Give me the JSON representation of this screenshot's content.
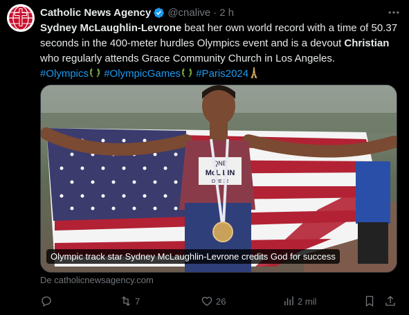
{
  "author": {
    "name": "Catholic News Agency",
    "handle": "@cnalive",
    "separator": "·",
    "time": "2 h",
    "avatar_icon": "cna-logo"
  },
  "tweet": {
    "part1_bold": "Sydney McLaughlin-Levrone",
    "part2": " beat her own world record with a time of 50.37 seconds in the 400-meter hurdles Olympics event and is a devout ",
    "part3_bold": "Christian",
    "part4": " who regularly attends Grace Community Church in Los Angeles.",
    "hashtags": [
      "#Olympics",
      "#OlympicGames",
      "#Paris2024"
    ],
    "hashtag_emojis": [
      "laurel-emoji",
      "laurel-emoji",
      "eiffel-tower-emoji"
    ]
  },
  "media": {
    "caption": "Olympic track star Sydney McLaughlin-Levrone credits God for success",
    "bib_line1": "QNB",
    "bib_line2": "McL   LIN",
    "bib_line3": "ORE   22"
  },
  "source": "De catholicnewsagency.com",
  "actions": {
    "reply": {
      "icon": "reply-icon",
      "count": ""
    },
    "retweet": {
      "icon": "retweet-icon",
      "count": "7"
    },
    "like": {
      "icon": "heart-icon",
      "count": "26"
    },
    "views": {
      "icon": "views-icon",
      "count": "2 mil"
    },
    "bookmark": {
      "icon": "bookmark-icon"
    },
    "share": {
      "icon": "share-icon"
    }
  },
  "colors": {
    "link": "#1d9bf0",
    "muted": "#71767b",
    "verified": "#1d9bf0",
    "flag_red": "#b22234",
    "flag_blue": "#3c3b6e"
  }
}
